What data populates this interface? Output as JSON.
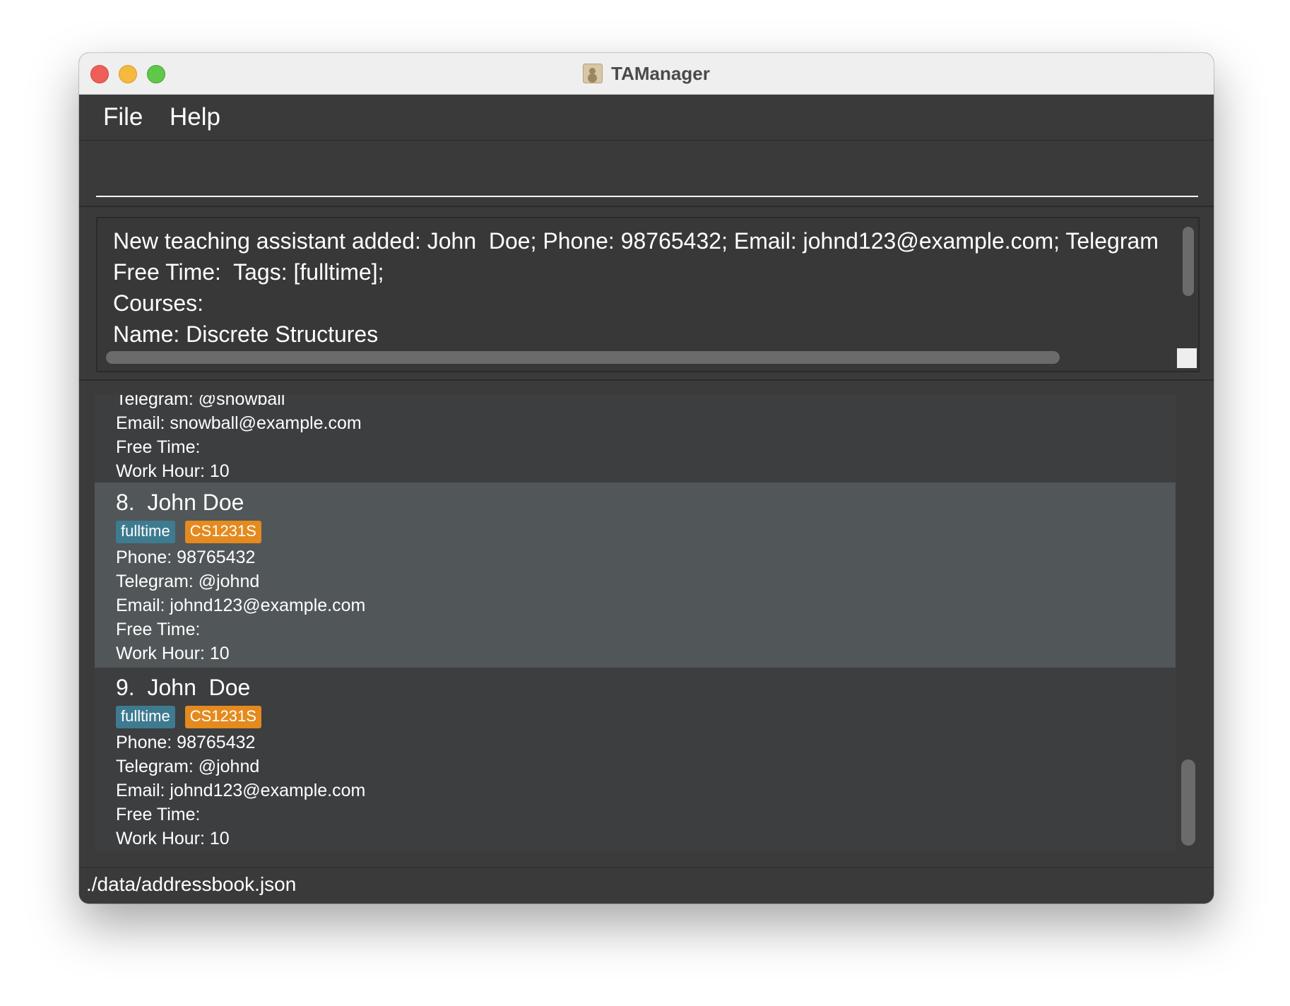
{
  "window": {
    "title": "TAManager",
    "icon": "address-book-icon"
  },
  "menu": {
    "file": "File",
    "help": "Help"
  },
  "command_box": {
    "value": "",
    "placeholder": ""
  },
  "result_display": {
    "lines": [
      "New teaching assistant added: John  Doe; Phone: 98765432; Email: johnd123@example.com; Telegram",
      "Free Time:  Tags: [fulltime];",
      "Courses:",
      "Name: Discrete Structures"
    ]
  },
  "ta_list": {
    "partial_card": {
      "telegram": "Telegram: @snowball",
      "email": "Email: snowball@example.com",
      "free_time": "Free Time:",
      "work_hour": "Work Hour: 10"
    },
    "cards": [
      {
        "name": "8.  John Doe",
        "tags": [
          "fulltime",
          "CS1231S"
        ],
        "phone": "Phone: 98765432",
        "telegram": "Telegram: @johnd",
        "email": "Email: johnd123@example.com",
        "free_time": "Free Time:",
        "work_hour": "Work Hour: 10",
        "selected": true
      },
      {
        "name": "9.  John  Doe",
        "tags": [
          "fulltime",
          "CS1231S"
        ],
        "phone": "Phone: 98765432",
        "telegram": "Telegram: @johnd",
        "email": "Email: johnd123@example.com",
        "free_time": "Free Time:",
        "work_hour": "Work Hour: 10",
        "selected": false
      }
    ]
  },
  "status_bar": {
    "path": "./data/addressbook.json"
  },
  "colors": {
    "tag_blue": "#3e7b91",
    "tag_orange": "#e48a1e",
    "selected_card": "#515659",
    "background": "#3c3e40"
  }
}
